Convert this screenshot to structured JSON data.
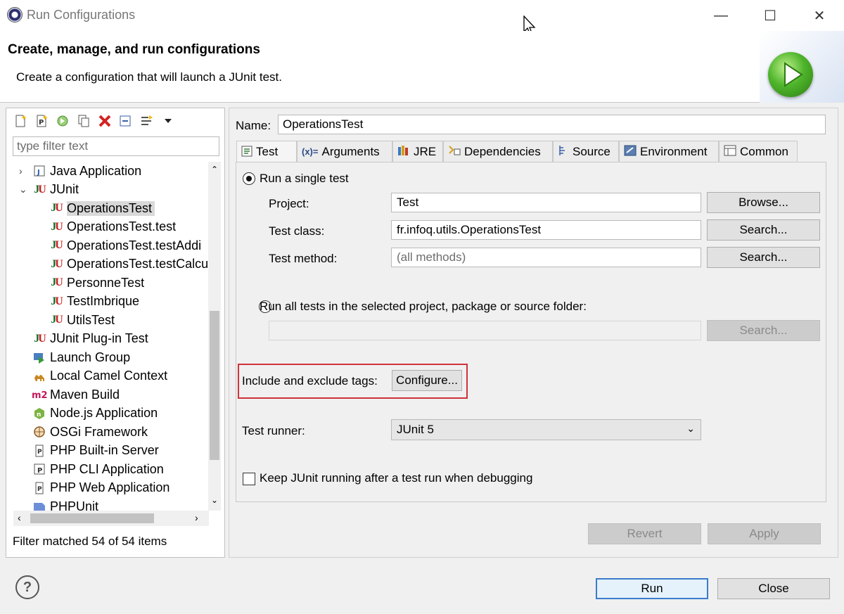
{
  "window": {
    "title": "Run Configurations",
    "minimize_glyph": "—",
    "maximize_glyph": "☐",
    "close_glyph": "✕"
  },
  "header": {
    "title": "Create, manage, and run configurations",
    "description": "Create a configuration that will launch a JUnit test."
  },
  "left": {
    "filter_placeholder": "type filter text",
    "tree": [
      {
        "label": "Java Application",
        "icon": "java-app-icon",
        "level": 0,
        "twisty": "›",
        "selected": false
      },
      {
        "label": "JUnit",
        "icon": "junit-icon",
        "level": 0,
        "twisty": "⌄",
        "selected": false
      },
      {
        "label": "OperationsTest",
        "icon": "junit-icon",
        "level": 1,
        "twisty": "",
        "selected": true
      },
      {
        "label": "OperationsTest.test",
        "icon": "junit-icon",
        "level": 1,
        "twisty": "",
        "selected": false
      },
      {
        "label": "OperationsTest.testAddi",
        "icon": "junit-icon",
        "level": 1,
        "twisty": "",
        "selected": false
      },
      {
        "label": "OperationsTest.testCalcu",
        "icon": "junit-icon",
        "level": 1,
        "twisty": "",
        "selected": false
      },
      {
        "label": "PersonneTest",
        "icon": "junit-icon",
        "level": 1,
        "twisty": "",
        "selected": false
      },
      {
        "label": "TestImbrique",
        "icon": "junit-icon",
        "level": 1,
        "twisty": "",
        "selected": false
      },
      {
        "label": "UtilsTest",
        "icon": "junit-icon",
        "level": 1,
        "twisty": "",
        "selected": false
      },
      {
        "label": "JUnit Plug-in Test",
        "icon": "junit-plugin-icon",
        "level": 0,
        "twisty": "",
        "selected": false
      },
      {
        "label": "Launch Group",
        "icon": "launch-group-icon",
        "level": 0,
        "twisty": "",
        "selected": false
      },
      {
        "label": "Local Camel Context",
        "icon": "camel-icon",
        "level": 0,
        "twisty": "",
        "selected": false
      },
      {
        "label": "Maven Build",
        "icon": "maven-icon",
        "level": 0,
        "twisty": "",
        "selected": false
      },
      {
        "label": "Node.js Application",
        "icon": "nodejs-icon",
        "level": 0,
        "twisty": "",
        "selected": false
      },
      {
        "label": "OSGi Framework",
        "icon": "osgi-icon",
        "level": 0,
        "twisty": "",
        "selected": false
      },
      {
        "label": "PHP Built-in Server",
        "icon": "php-server-icon",
        "level": 0,
        "twisty": "",
        "selected": false
      },
      {
        "label": "PHP CLI Application",
        "icon": "php-cli-icon",
        "level": 0,
        "twisty": "",
        "selected": false
      },
      {
        "label": "PHP Web Application",
        "icon": "php-web-icon",
        "level": 0,
        "twisty": "",
        "selected": false
      },
      {
        "label": "PHPUnit",
        "icon": "phpunit-icon",
        "level": 0,
        "twisty": "",
        "selected": false
      }
    ],
    "filter_status": "Filter matched 54 of 54 items"
  },
  "right": {
    "name_label": "Name:",
    "name_value": "OperationsTest",
    "tabs": [
      {
        "label": "Test",
        "icon": "test-tab-icon",
        "active": true
      },
      {
        "label": "Arguments",
        "icon": "arguments-tab-icon",
        "active": false
      },
      {
        "label": "JRE",
        "icon": "jre-tab-icon",
        "active": false
      },
      {
        "label": "Dependencies",
        "icon": "dependencies-tab-icon",
        "active": false
      },
      {
        "label": "Source",
        "icon": "source-tab-icon",
        "active": false
      },
      {
        "label": "Environment",
        "icon": "environment-tab-icon",
        "active": false
      },
      {
        "label": "Common",
        "icon": "common-tab-icon",
        "active": false
      }
    ],
    "single_test_label": "Run a single test",
    "project_label": "Project:",
    "project_value": "Test",
    "browse_label": "Browse...",
    "test_class_label": "Test class:",
    "test_class_value": "fr.infoq.utils.OperationsTest",
    "search_label": "Search...",
    "test_method_label": "Test method:",
    "test_method_placeholder": "(all methods)",
    "all_tests_label": "Run all tests in the selected project, package or source folder:",
    "tags_label": "Include and exclude tags:",
    "configure_label": "Configure...",
    "runner_label": "Test runner:",
    "runner_value": "JUnit 5",
    "keep_running_label": "Keep JUnit running after a test run when debugging",
    "revert_label": "Revert",
    "apply_label": "Apply"
  },
  "footer": {
    "help_glyph": "?",
    "run_label": "Run",
    "close_label": "Close"
  },
  "colors": {
    "highlight_border": "#d0323a",
    "default_button_border": "#3a7ccb"
  }
}
